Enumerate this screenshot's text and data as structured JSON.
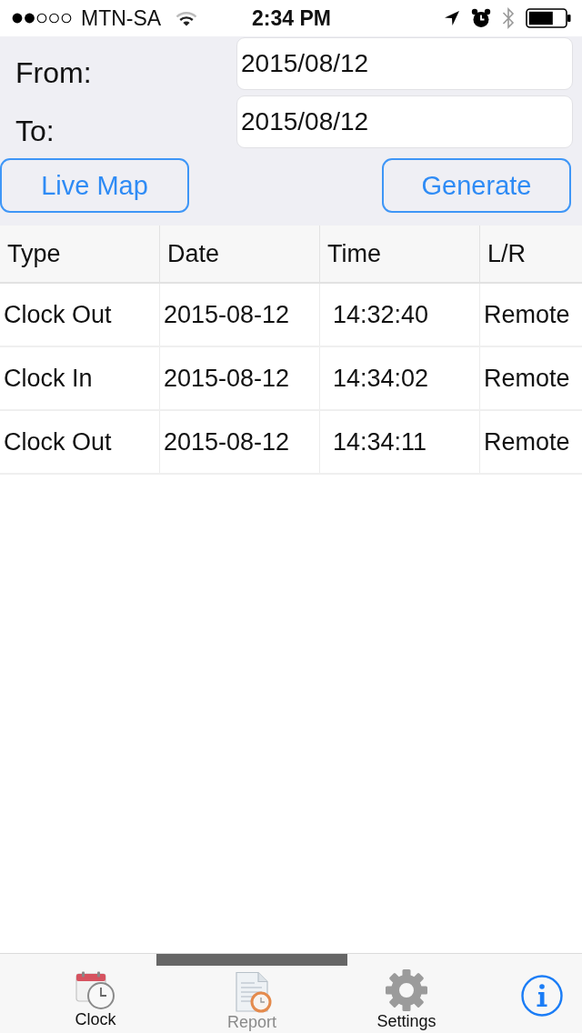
{
  "status_bar": {
    "carrier": "MTN-SA",
    "time": "2:34 PM"
  },
  "filter": {
    "fields": [
      {
        "label": "From:",
        "value": "2015/08/12"
      },
      {
        "label": "To:",
        "value": "2015/08/12"
      }
    ],
    "buttons": [
      "Live Map",
      "Generate"
    ]
  },
  "table": {
    "columns": [
      "Type",
      "Date",
      "Time",
      "L/R"
    ],
    "rows": [
      [
        "Clock Out",
        "2015-08-12",
        "14:32:40",
        "Remote"
      ],
      [
        "Clock In",
        "2015-08-12",
        "14:34:02",
        "Remote"
      ],
      [
        "Clock Out",
        "2015-08-12",
        "14:34:11",
        "Remote"
      ]
    ]
  },
  "tab_bar": {
    "tabs": [
      {
        "kind": "clock",
        "label": "Clock",
        "selected": false
      },
      {
        "kind": "report",
        "label": "Report",
        "selected": true
      },
      {
        "kind": "settings",
        "label": "Settings",
        "selected": false
      }
    ]
  }
}
